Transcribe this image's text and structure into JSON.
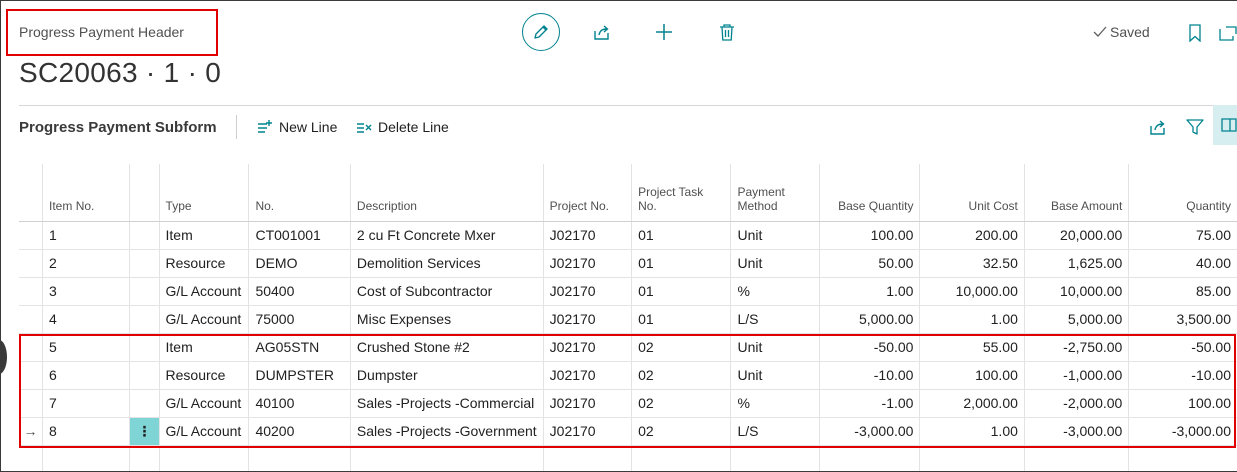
{
  "header": {
    "caption": "Progress Payment Header",
    "title": "SC20063 · 1 · 0",
    "saved_label": "Saved"
  },
  "subform": {
    "title": "Progress Payment Subform",
    "new_line_label": "New Line",
    "delete_line_label": "Delete Line"
  },
  "grid": {
    "columns": {
      "item_no": "Item No.",
      "type": "Type",
      "no": "No.",
      "description": "Description",
      "project_no": "Project No.",
      "project_task_no_1": "Project Task",
      "project_task_no_2": "No.",
      "payment_method_1": "Payment",
      "payment_method_2": "Method",
      "base_quantity": "Base Quantity",
      "unit_cost": "Unit Cost",
      "base_amount": "Base Amount",
      "quantity": "Quantity"
    },
    "rows": [
      {
        "item_no": "1",
        "type": "Item",
        "no": "CT001001",
        "description": "2 cu Ft Concrete Mxer",
        "project_no": "J02170",
        "task_no": "01",
        "payment_method": "Unit",
        "base_quantity": "100.00",
        "unit_cost": "200.00",
        "base_amount": "20,000.00",
        "quantity": "75.00",
        "indicator": "",
        "menu": ""
      },
      {
        "item_no": "2",
        "type": "Resource",
        "no": "DEMO",
        "description": "Demolition Services",
        "project_no": "J02170",
        "task_no": "01",
        "payment_method": "Unit",
        "base_quantity": "50.00",
        "unit_cost": "32.50",
        "base_amount": "1,625.00",
        "quantity": "40.00",
        "indicator": "",
        "menu": ""
      },
      {
        "item_no": "3",
        "type": "G/L Account",
        "no": "50400",
        "description": "Cost of Subcontractor",
        "project_no": "J02170",
        "task_no": "01",
        "payment_method": "%",
        "base_quantity": "1.00",
        "unit_cost": "10,000.00",
        "base_amount": "10,000.00",
        "quantity": "85.00",
        "indicator": "",
        "menu": ""
      },
      {
        "item_no": "4",
        "type": "G/L Account",
        "no": "75000",
        "description": "Misc Expenses",
        "project_no": "J02170",
        "task_no": "01",
        "payment_method": "L/S",
        "base_quantity": "5,000.00",
        "unit_cost": "1.00",
        "base_amount": "5,000.00",
        "quantity": "3,500.00",
        "indicator": "",
        "menu": ""
      },
      {
        "item_no": "5",
        "type": "Item",
        "no": "AG05STN",
        "description": "Crushed Stone #2",
        "project_no": "J02170",
        "task_no": "02",
        "payment_method": "Unit",
        "base_quantity": "-50.00",
        "unit_cost": "55.00",
        "base_amount": "-2,750.00",
        "quantity": "-50.00",
        "indicator": "",
        "menu": ""
      },
      {
        "item_no": "6",
        "type": "Resource",
        "no": "DUMPSTER",
        "description": "Dumpster",
        "project_no": "J02170",
        "task_no": "02",
        "payment_method": "Unit",
        "base_quantity": "-10.00",
        "unit_cost": "100.00",
        "base_amount": "-1,000.00",
        "quantity": "-10.00",
        "indicator": "",
        "menu": ""
      },
      {
        "item_no": "7",
        "type": "G/L Account",
        "no": "40100",
        "description": "Sales -Projects -Commercial",
        "project_no": "J02170",
        "task_no": "02",
        "payment_method": "%",
        "base_quantity": "-1.00",
        "unit_cost": "2,000.00",
        "base_amount": "-2,000.00",
        "quantity": "100.00",
        "indicator": "",
        "menu": ""
      },
      {
        "item_no": "8",
        "type": "G/L Account",
        "no": "40200",
        "description": "Sales -Projects -Government",
        "project_no": "J02170",
        "task_no": "02",
        "payment_method": "L/S",
        "base_quantity": "-3,000.00",
        "unit_cost": "1.00",
        "base_amount": "-3,000.00",
        "quantity": "-3,000.00",
        "indicator": "→",
        "menu": "⋮"
      }
    ]
  },
  "colors": {
    "accent": "#00838f",
    "highlight_border": "#e00000",
    "active_cell": "#7fd4d6"
  }
}
